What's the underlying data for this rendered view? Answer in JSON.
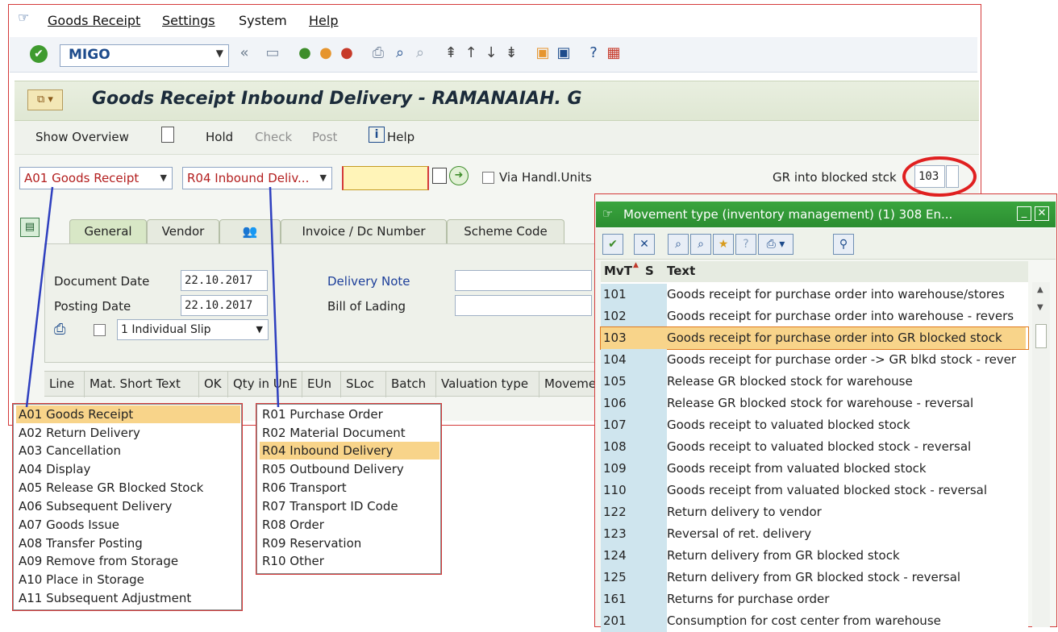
{
  "menu": {
    "items": [
      "Goods Receipt",
      "Settings",
      "System",
      "Help"
    ]
  },
  "toolbar": {
    "tcode": "MIGO"
  },
  "title": "Goods Receipt Inbound Delivery - RAMANAIAH. G",
  "app_toolbar": {
    "show_overview": "Show Overview",
    "hold": "Hold",
    "check": "Check",
    "post": "Post",
    "help": "Help"
  },
  "selectors": {
    "action": "A01 Goods Receipt",
    "reference": "R04 Inbound Deliv...",
    "via_handl_units": "Via Handl.Units",
    "gr_label": "GR into blocked stck",
    "gr_value": "103"
  },
  "tabs": [
    "General",
    "Vendor",
    "Invoice / Dc Number",
    "Scheme Code"
  ],
  "header_fields": {
    "document_date_label": "Document Date",
    "document_date": "22.10.2017",
    "posting_date_label": "Posting Date",
    "posting_date": "22.10.2017",
    "slip": "1 Individual Slip",
    "delivery_note_label": "Delivery Note",
    "bill_of_lading_label": "Bill of Lading"
  },
  "grid_columns": [
    "Line",
    "Mat. Short Text",
    "OK",
    "Qty in UnE",
    "EUn",
    "SLoc",
    "Batch",
    "Valuation type",
    "Moveme"
  ],
  "action_list": [
    "A01 Goods Receipt",
    "A02 Return Delivery",
    "A03 Cancellation",
    "A04 Display",
    "A05 Release GR Blocked Stock",
    "A06 Subsequent Delivery",
    "A07 Goods Issue",
    "A08 Transfer Posting",
    "A09 Remove from Storage",
    "A10 Place in Storage",
    "A11 Subsequent Adjustment"
  ],
  "reference_list": [
    "R01 Purchase Order",
    "R02 Material Document",
    "R04 Inbound Delivery",
    "R05 Outbound Delivery",
    "R06 Transport",
    "R07 Transport ID Code",
    "R08 Order",
    "R09 Reservation",
    "R10 Other"
  ],
  "mvt_dialog": {
    "title": "Movement type (inventory management) (1)  308 En...",
    "col_mvt": "MvT",
    "col_s": "S",
    "col_text": "Text",
    "rows": [
      {
        "code": "101",
        "text": "Goods receipt for purchase order into warehouse/stores"
      },
      {
        "code": "102",
        "text": "Goods receipt for purchase order into warehouse - revers"
      },
      {
        "code": "103",
        "text": "Goods receipt for purchase order into GR blocked stock"
      },
      {
        "code": "104",
        "text": "Goods receipt for purchase order -> GR blkd stock - rever"
      },
      {
        "code": "105",
        "text": "Release GR blocked stock for warehouse"
      },
      {
        "code": "106",
        "text": "Release GR blocked stock for warehouse - reversal"
      },
      {
        "code": "107",
        "text": "Goods receipt to valuated blocked stock"
      },
      {
        "code": "108",
        "text": "Goods receipt to valuated blocked stock - reversal"
      },
      {
        "code": "109",
        "text": "Goods receipt from valuated blocked stock"
      },
      {
        "code": "110",
        "text": "Goods receipt from valuated blocked stock - reversal"
      },
      {
        "code": "122",
        "text": "Return delivery to vendor"
      },
      {
        "code": "123",
        "text": "Reversal of ret. delivery"
      },
      {
        "code": "124",
        "text": "Return delivery from GR blocked stock"
      },
      {
        "code": "125",
        "text": "Return delivery from GR blocked stock - reversal"
      },
      {
        "code": "161",
        "text": "Returns for purchase order"
      },
      {
        "code": "201",
        "text": "Consumption for cost center from warehouse"
      }
    ]
  }
}
